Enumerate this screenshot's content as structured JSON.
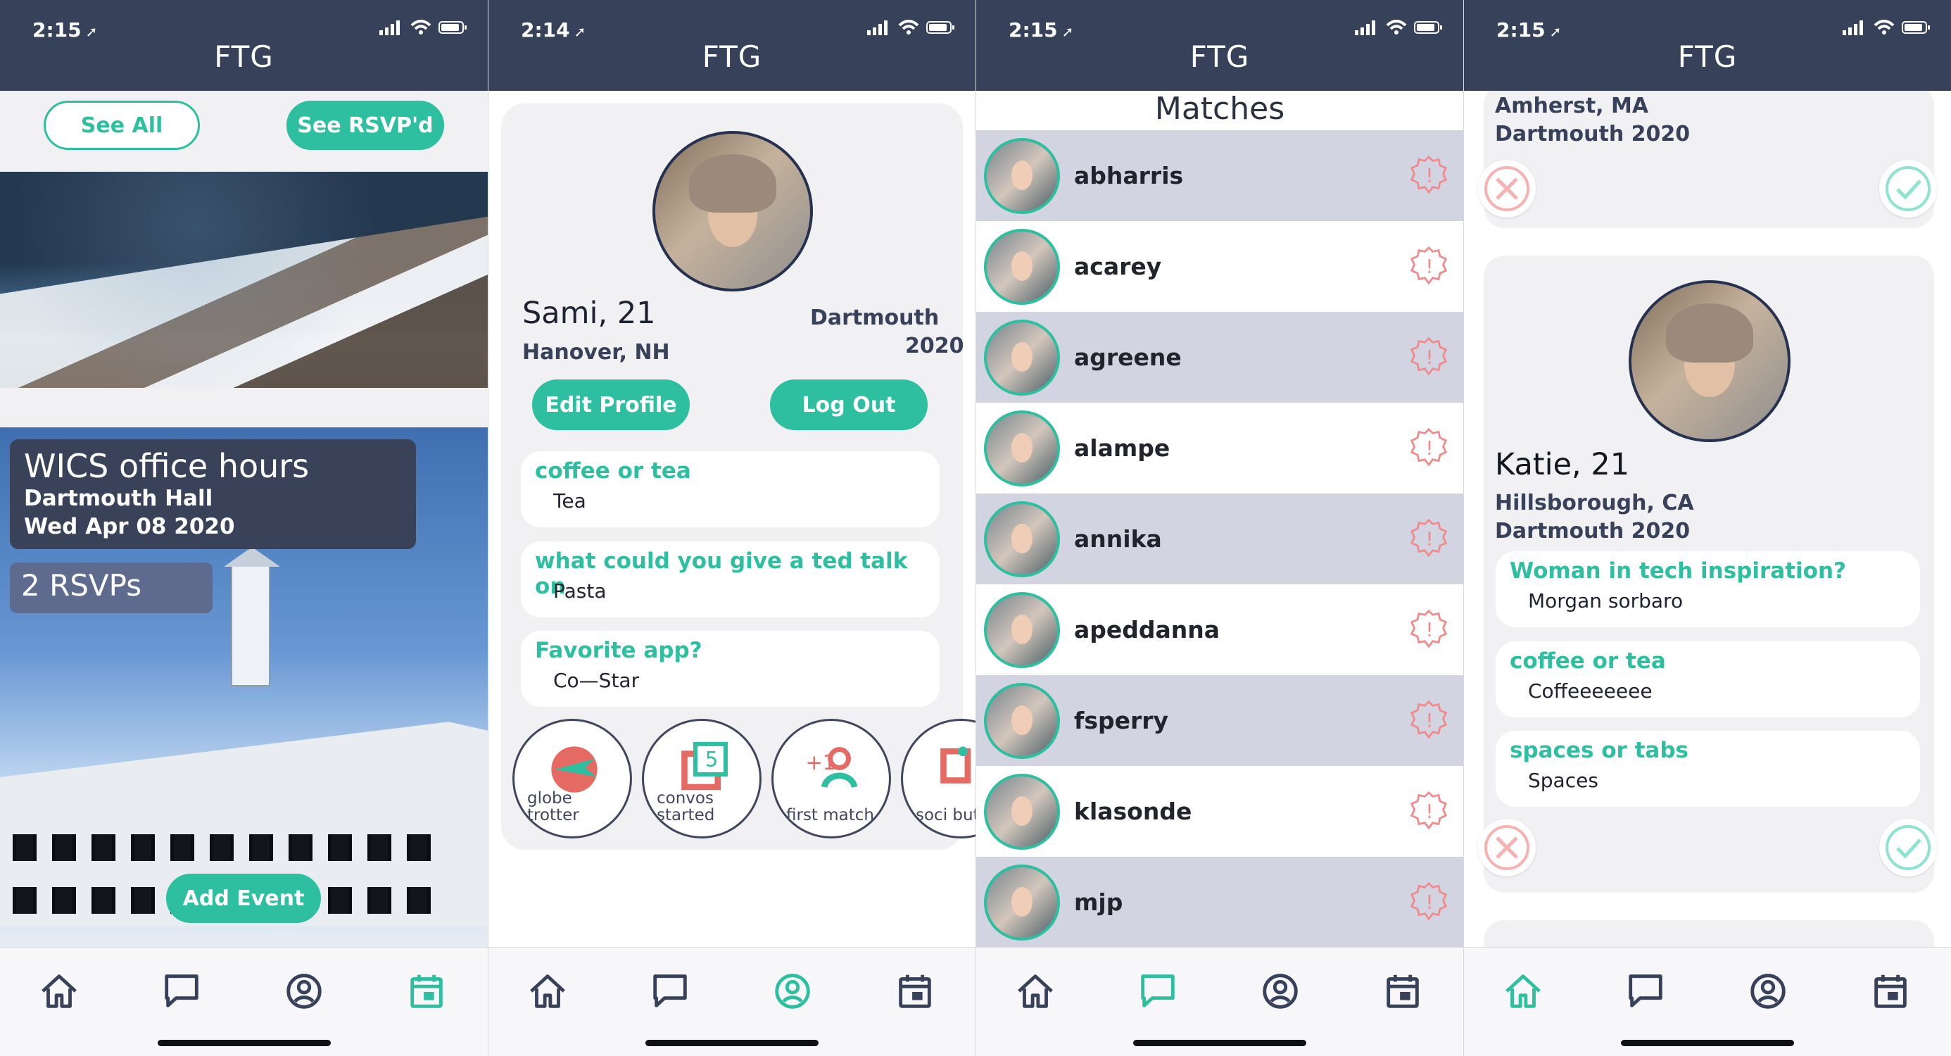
{
  "screens": [
    {
      "status": {
        "time": "2:15",
        "location_icon": "location-arrow-icon"
      },
      "title": "FTG",
      "buttons": {
        "see_all": "See All",
        "see_rsvpd": "See RSVP'd",
        "add_event": "Add Event"
      },
      "event": {
        "title": "WICS office hours",
        "location": "Dartmouth Hall",
        "date": "Wed Apr 08 2020",
        "rsvps": "2 RSVPs"
      },
      "tabs": [
        "home-icon",
        "chat-icon",
        "profile-icon",
        "calendar-icon"
      ],
      "active_tab": "calendar-icon"
    },
    {
      "status": {
        "time": "2:14",
        "location_icon": "location-arrow-icon"
      },
      "title": "FTG",
      "profile": {
        "name": "Sami, 21",
        "location": "Hanover, NH",
        "school": "Dartmouth",
        "year": "2020",
        "edit_profile": "Edit Profile",
        "log_out": "Log Out",
        "qa": [
          {
            "question": "coffee or tea",
            "answer": "Tea"
          },
          {
            "question": "what could you give a ted talk on",
            "answer": "Pasta"
          },
          {
            "question": "Favorite app?",
            "answer": "Co—Star"
          }
        ],
        "badges": [
          {
            "label": "globe trotter",
            "icon": "airplane-icon"
          },
          {
            "label": "convos started",
            "icon": "chat-stack-icon"
          },
          {
            "label": "first match",
            "icon": "users-plus-icon"
          },
          {
            "label": "soci but",
            "icon": "badge-icon"
          }
        ]
      },
      "tabs": [
        "home-icon",
        "chat-icon",
        "profile-icon",
        "calendar-icon"
      ],
      "active_tab": "profile-icon"
    },
    {
      "status": {
        "time": "2:15",
        "location_icon": "location-arrow-icon"
      },
      "title": "FTG",
      "matches_title": "Matches",
      "matches": [
        {
          "name": "abharris"
        },
        {
          "name": "acarey"
        },
        {
          "name": "agreene"
        },
        {
          "name": "alampe"
        },
        {
          "name": "annika"
        },
        {
          "name": "apeddanna"
        },
        {
          "name": "fsperry"
        },
        {
          "name": "klasonde"
        },
        {
          "name": "mjp"
        }
      ],
      "tabs": [
        "home-icon",
        "chat-icon",
        "profile-icon",
        "calendar-icon"
      ],
      "active_tab": "chat-icon"
    },
    {
      "status": {
        "time": "2:15",
        "location_icon": "location-arrow-icon"
      },
      "title": "FTG",
      "previous_profile": {
        "location": "Amherst, MA",
        "school_year": "Dartmouth 2020"
      },
      "profile": {
        "name": "Katie, 21",
        "location": "Hillsborough, CA",
        "school_year": "Dartmouth 2020",
        "qa": [
          {
            "question": "Woman in tech inspiration?",
            "answer": "Morgan sorbaro"
          },
          {
            "question": "coffee or tea",
            "answer": "Coffeeeeeee"
          },
          {
            "question": "spaces or tabs",
            "answer": "Spaces"
          }
        ]
      },
      "tabs": [
        "home-icon",
        "chat-icon",
        "profile-icon",
        "calendar-icon"
      ],
      "active_tab": "home-icon"
    }
  ],
  "colors": {
    "primary": "#374159",
    "accent": "#2dbf9f",
    "reject": "#f08b8b",
    "card": "#f1f1f3"
  }
}
